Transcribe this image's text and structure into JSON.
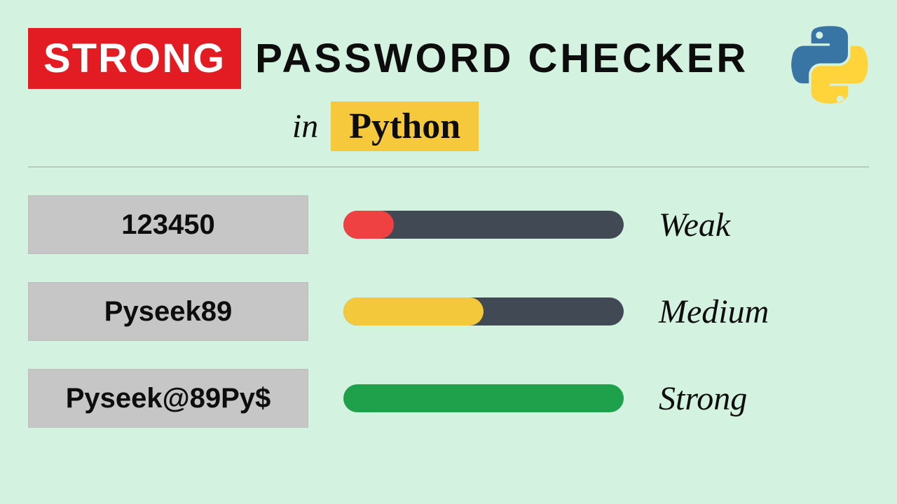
{
  "header": {
    "badge": "STRONG",
    "rest": "PASSWORD CHECKER"
  },
  "subheader": {
    "in_label": "in",
    "python_label": "Python"
  },
  "colors": {
    "bg": "#d3f2df",
    "red": "#e31b23",
    "yellow": "#f5c93b",
    "track": "#414954",
    "weak": "#ef4141",
    "medium": "#f3c93b",
    "strong": "#1fa04b",
    "box": "#c6c6c6"
  },
  "logo": {
    "name": "python-logo-icon",
    "blue": "#3874a4",
    "yellow": "#ffd43b"
  },
  "rows": [
    {
      "password": "123450",
      "strength_label": "Weak",
      "fill_pct": 18,
      "fill_color": "#ef4141",
      "show_track": true
    },
    {
      "password": "Pyseek89",
      "strength_label": "Medium",
      "fill_pct": 50,
      "fill_color": "#f3c93b",
      "show_track": true
    },
    {
      "password": "Pyseek@89Py$",
      "strength_label": "Strong",
      "fill_pct": 100,
      "fill_color": "#1fa04b",
      "show_track": false
    }
  ]
}
